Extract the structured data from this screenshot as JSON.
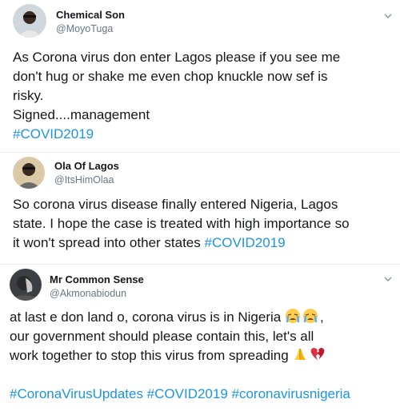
{
  "tweets": [
    {
      "name": "Chemical Son",
      "handle": "@MoyoTuga",
      "lines": [
        "As Corona virus don enter Lagos please if you see me",
        "don't hug or shake me even chop knuckle now sef is",
        "risky.",
        "Signed....management"
      ],
      "hashtags": "#COVID2019",
      "avatar_icon": "profile-photo"
    },
    {
      "name": "Ola Of Lagos",
      "handle": "@ItsHimOlaa",
      "lines": [
        "So corona virus disease finally entered Nigeria, Lagos",
        "state. I hope the case is treated with high importance so",
        "it won't spread into other states "
      ],
      "hashtag_inline": "#COVID2019",
      "avatar_icon": "profile-photo"
    },
    {
      "name": "Mr Common Sense",
      "handle": "@Akmonabiodun",
      "line1": "at last e don land o, corona virus is in Nigeria",
      "line2": "our government should please contain this, let's all",
      "line3": "work together to stop this virus from spreading",
      "hashtags": "#CoronaVirusUpdates #COVID2019 #coronavirusnigeria",
      "emoji": [
        "crying-face",
        "crying-face",
        "folded-hands",
        "broken-heart"
      ],
      "avatar_icon": "profile-photo"
    }
  ],
  "colors": {
    "text": "#14171a",
    "handle": "#657786",
    "hashtag": "#1b95e0",
    "divider": "#e6ecf0"
  }
}
